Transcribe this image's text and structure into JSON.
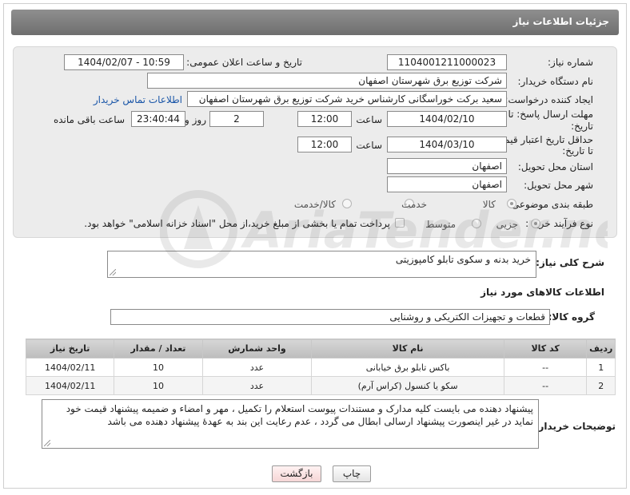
{
  "header": {
    "title": "جزئیات اطلاعات نیاز"
  },
  "form": {
    "need_number": {
      "label": "شماره نیاز:",
      "value": "1104001211000023"
    },
    "announce_datetime": {
      "label": "تاریخ و ساعت اعلان عمومی:",
      "value": "1404/02/07 - 10:59"
    },
    "buyer_org": {
      "label": "نام دستگاه خریدار:",
      "value": "شرکت توزیع برق شهرستان اصفهان"
    },
    "requester": {
      "label": "ایجاد کننده درخواست:",
      "value": "سعید برکت خوراسگانی کارشناس خرید شرکت توزیع برق شهرستان اصفهان",
      "contact_link": "اطلاعات تماس خریدار"
    },
    "reply_deadline": {
      "label_line1": "مهلت ارسال پاسخ: تا",
      "label_line2": "تاریخ:",
      "date": "1404/02/10",
      "time_label": "ساعت",
      "time": "12:00",
      "days": "2",
      "days_label": "روز و",
      "remaining": "23:40:44",
      "remaining_label": "ساعت باقی مانده"
    },
    "price_validity": {
      "label_line1": "حداقل تاریخ اعتبار قیمت:",
      "label_line2": "تا تاریخ:",
      "date": "1404/03/10",
      "time_label": "ساعت",
      "time": "12:00"
    },
    "delivery_province": {
      "label": "استان محل تحویل:",
      "value": "اصفهان"
    },
    "delivery_city": {
      "label": "شهر محل تحویل:",
      "value": "اصفهان"
    },
    "category": {
      "label": "طبقه بندی موضوعی:",
      "options": [
        "کالا",
        "خدمت",
        "کالا/خدمت"
      ],
      "selected": "کالا"
    },
    "purchase_type": {
      "label": "نوع فرآیند خرید :",
      "options": [
        "جزیی",
        "متوسط"
      ],
      "selected": "جزیی",
      "note": "پرداخت تمام یا بخشی از مبلغ خرید،از محل \"اسناد خزانه اسلامی\" خواهد بود."
    }
  },
  "summary": {
    "label": "شرح کلی نیاز:",
    "value": "خرید بدنه  و سکوی تابلو کامپوزیتی"
  },
  "goods_section": {
    "title": "اطلاعات کالاهای مورد نیاز"
  },
  "goods_group": {
    "label": "گروه کالا:",
    "value": "قطعات و تجهیزات الکتریکی و روشنایی"
  },
  "table": {
    "headers": [
      "ردیف",
      "کد کالا",
      "نام کالا",
      "واحد شمارش",
      "تعداد / مقدار",
      "تاریخ نیاز"
    ],
    "rows": [
      [
        "1",
        "--",
        "باکس تابلو برق خیابانی",
        "عدد",
        "10",
        "1404/02/11"
      ],
      [
        "2",
        "--",
        "سکو یا کنسول (کراس آرم)",
        "عدد",
        "10",
        "1404/02/11"
      ]
    ]
  },
  "buyer_notes": {
    "label": "توضیحات خریدار:",
    "value": "پیشنهاد دهنده می بایست کلیه مدارک و مستندات پیوست استعلام را تکمیل ، مهر و امضاء و ضمیمه پیشنهاد قیمت خود نماید در غیر اینصورت پیشنهاد ارسالی ابطال می گردد ، عدم رعایت این بند به عهدهٔ پیشنهاد دهنده می باشد"
  },
  "buttons": {
    "print": "چاپ",
    "back": "بازگشت"
  },
  "watermark": {
    "text": "AriaTender.net"
  },
  "colors": {
    "header_bg": "#7a7a7a",
    "panel_bg": "#ececec",
    "link": "#1a56a8",
    "back_button_bg": "#fbe3e3"
  }
}
